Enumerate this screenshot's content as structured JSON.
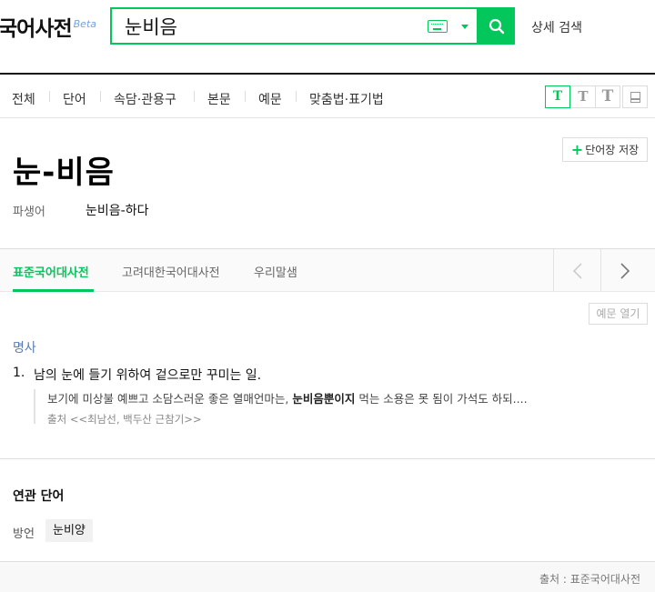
{
  "header": {
    "logo": "국어사전",
    "logo_badge": "Beta",
    "search_value": "눈비음",
    "detail_search": "상세 검색",
    "icons": {
      "keyboard": "keyboard-icon",
      "dropdown": "chevron-down-icon",
      "search": "search-icon"
    },
    "accent_color": "#03c75a"
  },
  "nav": {
    "items": [
      "전체",
      "단어",
      "속담·관용구",
      "본문",
      "예문",
      "맞춤법·표기법"
    ],
    "font_size_buttons": [
      "T",
      "T",
      "T"
    ]
  },
  "entry": {
    "save_label": "단어장 저장",
    "headword": "눈-비음",
    "derivative_label": "파생어",
    "derivative_value": "눈비음-하다"
  },
  "tabs": {
    "items": [
      "표준국어대사전",
      "고려대한국어대사전",
      "우리말샘"
    ]
  },
  "definition": {
    "example_toggle": "예문 열기",
    "pos": "명사",
    "number": "1.",
    "text": "남의 눈에 들기 위하여 겉으로만 꾸미는 일.",
    "example_before": "보기에 미상불 예쁘고 소담스러운 좋은 열매언마는, ",
    "example_bold": "눈비음뿐이지",
    "example_after": " 먹는 소용은 못 됨이 가석도 하되....",
    "example_source": "출처 <<최남선, 백두산 근참기>>"
  },
  "related": {
    "title": "연관 단어",
    "label": "방언",
    "word": "눈비양"
  },
  "footer": {
    "source": "출처 : 표준국어대사전"
  }
}
